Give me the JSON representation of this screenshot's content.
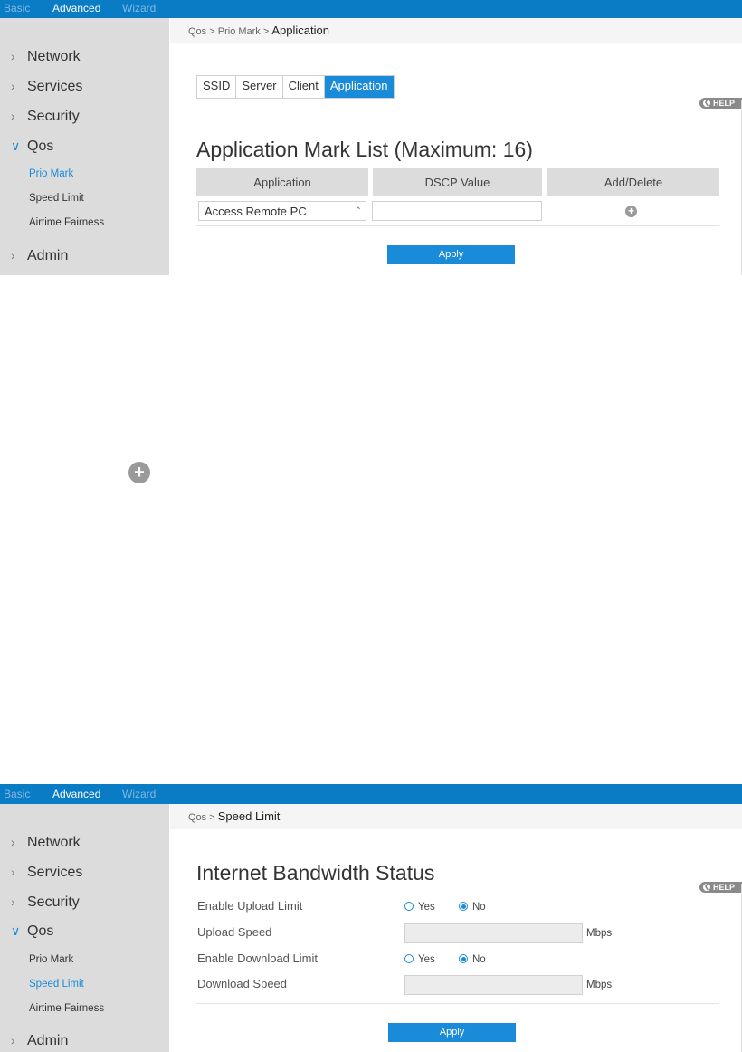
{
  "top_nav": [
    "Basic",
    "Advanced",
    "Wizard"
  ],
  "screen1": {
    "sidebar": {
      "items": [
        "Network",
        "Services",
        "Security",
        "Qos",
        "Admin"
      ],
      "qos_sub": [
        "Prio Mark",
        "Speed Limit",
        "Airtime Fairness"
      ]
    },
    "breadcrumb": {
      "part1": "Qos",
      "sep": ">",
      "part2": "Prio Mark",
      "current": "Application"
    },
    "tabs": [
      "SSID",
      "Server",
      "Client",
      "Application"
    ],
    "help": "HELP",
    "title": "Application Mark List (Maximum: 16)",
    "table": {
      "headers": [
        "Application",
        "DSCP Value",
        "Add/Delete"
      ],
      "row": {
        "application": "Access Remote PC",
        "dscp": ""
      }
    },
    "apply": "Apply"
  },
  "screen2": {
    "sidebar": {
      "items": [
        "Network",
        "Services",
        "Security",
        "Qos",
        "Admin"
      ],
      "qos_sub": [
        "Prio Mark",
        "Speed Limit",
        "Airtime Fairness"
      ]
    },
    "breadcrumb": {
      "part1": "Qos",
      "sep": ">",
      "current": "Speed Limit"
    },
    "help": "HELP",
    "title": "Internet Bandwidth Status",
    "fields": {
      "upload_limit_label": "Enable Upload Limit",
      "upload_speed_label": "Upload Speed",
      "download_limit_label": "Enable Download Limit",
      "download_speed_label": "Download Speed",
      "yes": "Yes",
      "no": "No",
      "upload_limit_value": "No",
      "download_limit_value": "No",
      "upload_speed_value": "",
      "download_speed_value": "",
      "unit": "Mbps"
    },
    "apply": "Apply"
  },
  "colors": {
    "topbar": "#0a7bc5",
    "accent": "#1a8bd8",
    "sidebar_bg": "#dcdcdc"
  },
  "icons": {
    "chevron_right": "chevron-right-icon",
    "chevron_down": "chevron-down-icon",
    "add": "plus-circle-icon",
    "help": "help-icon"
  }
}
